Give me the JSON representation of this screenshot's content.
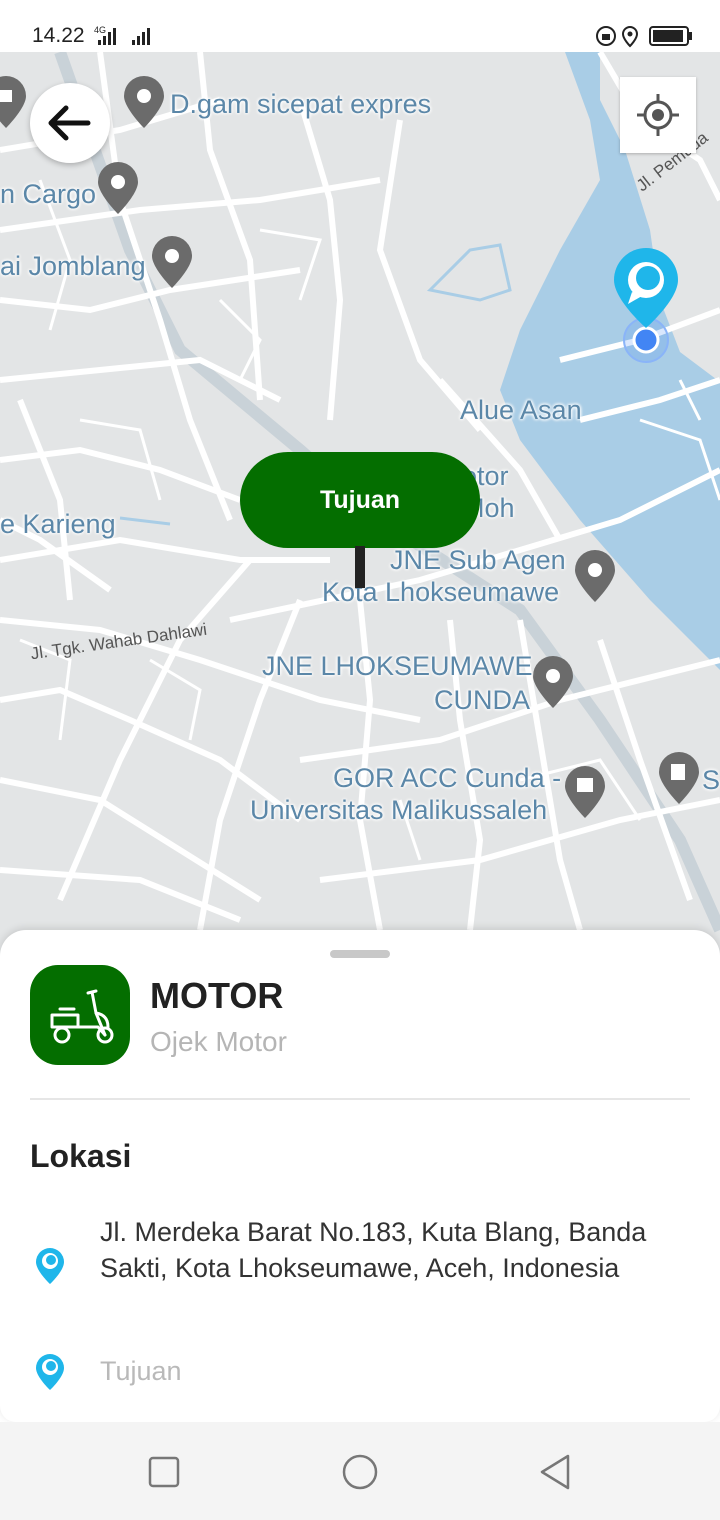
{
  "status_bar": {
    "time": "14.22",
    "network": "4G"
  },
  "map": {
    "labels": {
      "dgam": "D.gam sicepat expres",
      "cargo": "n Cargo",
      "jomblang": "ai Jomblang",
      "alue_asan": "Alue Asan",
      "karieng": "e Karieng",
      "motor_partial": "otor",
      "moh_partial": "Moh",
      "jne_sub_1": "JNE Sub Agen",
      "jne_sub_2": "Kota Lhokseumawe",
      "jne_lhok_1": "JNE LHOKSEUMAWE",
      "jne_lhok_2": "CUNDA",
      "gor_1": "GOR ACC Cunda -",
      "gor_2": "Universitas Malikussaleh",
      "s_partial": "S",
      "jl_pemuda": "Jl. Pemuda",
      "jl_dahlawi": "Jl. Tgk. Wahab Dahlawi"
    },
    "destination_pin_label": "Tujuan"
  },
  "sheet": {
    "service_name": "MOTOR",
    "service_subtitle": "Ojek Motor",
    "section_title": "Lokasi",
    "pickup_address": "Jl. Merdeka Barat No.183, Kuta Blang, Banda Sakti, Kota Lhokseumawe, Aceh, Indonesia",
    "destination_placeholder": "Tujuan"
  },
  "colors": {
    "brand_green": "#046e00",
    "map_land": "#e3e5e6",
    "map_water": "#a9cde6",
    "pin_blue": "#1fb6ea",
    "label_blue": "#5b87a8"
  }
}
